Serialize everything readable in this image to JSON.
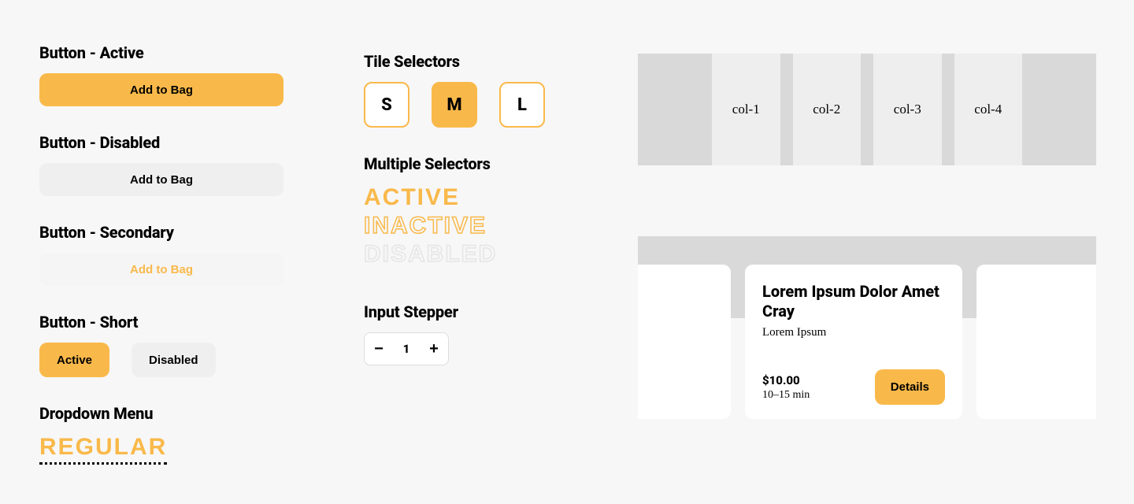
{
  "colors": {
    "accent": "#f9b94a"
  },
  "buttons_section": {
    "active": {
      "heading": "Button - Active",
      "label": "Add to Bag"
    },
    "disabled": {
      "heading": "Button - Disabled",
      "label": "Add to Bag"
    },
    "secondary": {
      "heading": "Button - Secondary",
      "label": "Add to Bag"
    },
    "short": {
      "heading": "Button - Short",
      "active_label": "Active",
      "disabled_label": "Disabled"
    }
  },
  "dropdown": {
    "heading": "Dropdown Menu",
    "value": "REGULAR"
  },
  "tiles": {
    "heading": "Tile Selectors",
    "options": {
      "s": "S",
      "m": "M",
      "l": "L"
    },
    "selected": "M"
  },
  "multi": {
    "heading": "Multiple Selectors",
    "active": "ACTIVE",
    "inactive": "INACTIVE",
    "disabled": "DISABLED"
  },
  "stepper": {
    "heading": "Input Stepper",
    "value": "1",
    "minus": "−",
    "plus": "+"
  },
  "grid": {
    "c1": "col-1",
    "c2": "col-2",
    "c3": "col-3",
    "c4": "col-4"
  },
  "card": {
    "title": "Lorem Ipsum Dolor Amet Cray",
    "subtitle": "Lorem Ipsum",
    "price": "$10.00",
    "eta": "10–15 min",
    "cta": "Details"
  }
}
